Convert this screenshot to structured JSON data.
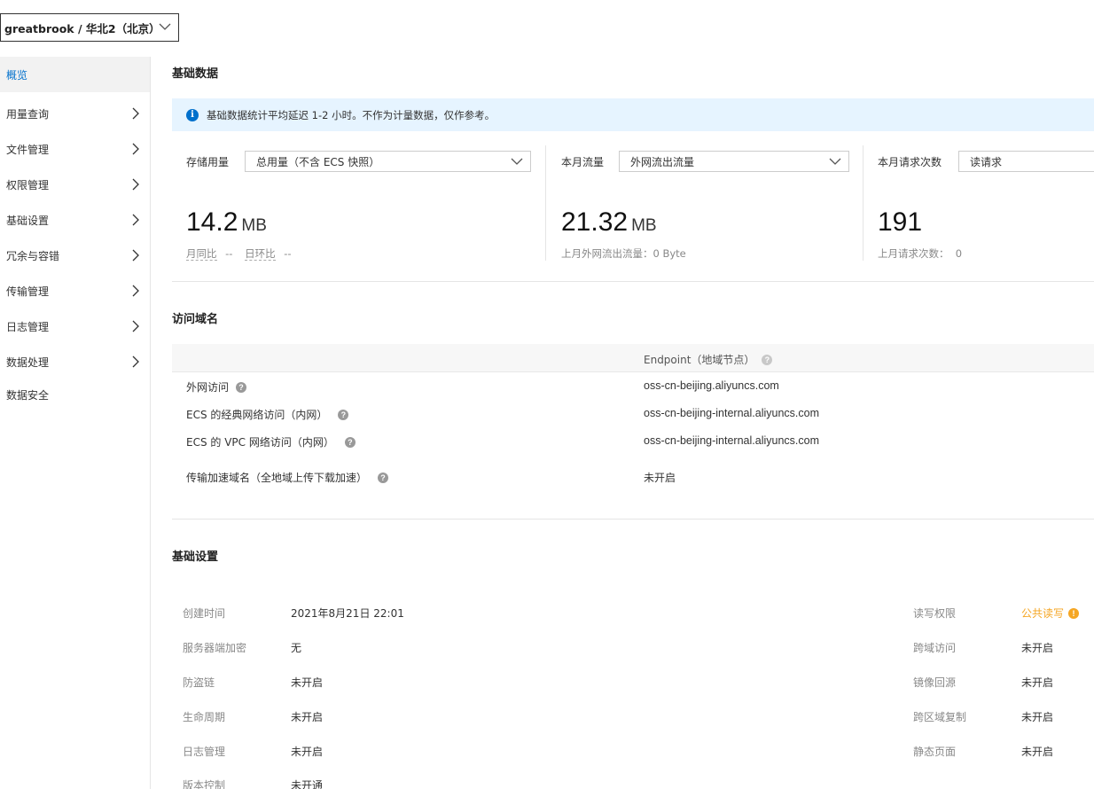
{
  "bucket_selector": {
    "label": "greatbrook / 华北2（北京）"
  },
  "sidebar": {
    "items": [
      {
        "label": "概览",
        "active": true,
        "has_arrow": false
      },
      {
        "label": "用量查询",
        "has_arrow": true
      },
      {
        "label": "文件管理",
        "has_arrow": true
      },
      {
        "label": "权限管理",
        "has_arrow": true
      },
      {
        "label": "基础设置",
        "has_arrow": true
      },
      {
        "label": "冗余与容错",
        "has_arrow": true
      },
      {
        "label": "传输管理",
        "has_arrow": true
      },
      {
        "label": "日志管理",
        "has_arrow": true
      },
      {
        "label": "数据处理",
        "has_arrow": true
      },
      {
        "label": "数据安全",
        "has_arrow": false
      }
    ]
  },
  "basic_data": {
    "title": "基础数据",
    "notice": "基础数据统计平均延迟 1-2 小时。不作为计量数据，仅作参考。",
    "storage": {
      "label": "存储用量",
      "dropdown": "总用量（不含 ECS 快照）",
      "value": "14.2",
      "unit": "MB",
      "mom_label": "月同比",
      "mom_value": "--",
      "dod_label": "日环比",
      "dod_value": "--"
    },
    "traffic": {
      "label": "本月流量",
      "dropdown": "外网流出流量",
      "value": "21.32",
      "unit": "MB",
      "sub": "上月外网流出流量：0 Byte"
    },
    "requests": {
      "label": "本月请求次数",
      "dropdown": "读请求",
      "value": "191",
      "sub": "上月请求次数：  0"
    }
  },
  "domains": {
    "title": "访问域名",
    "column_header": "Endpoint（地域节点）",
    "rows": [
      {
        "name": "外网访问",
        "value": "oss-cn-beijing.aliyuncs.com"
      },
      {
        "name": "ECS 的经典网络访问（内网）",
        "value": "oss-cn-beijing-internal.aliyuncs.com"
      },
      {
        "name": "ECS 的 VPC 网络访问（内网）",
        "value": "oss-cn-beijing-internal.aliyuncs.com"
      },
      {
        "name": "传输加速域名（全地域上传下载加速）",
        "value": "未开启"
      }
    ]
  },
  "settings": {
    "title": "基础设置",
    "left": [
      {
        "key": "创建时间",
        "value": "2021年8月21日 22:01"
      },
      {
        "key": "服务器端加密",
        "value": "无"
      },
      {
        "key": "防盗链",
        "value": "未开启"
      },
      {
        "key": "生命周期",
        "value": "未开启"
      },
      {
        "key": "日志管理",
        "value": "未开启"
      },
      {
        "key": "版本控制",
        "value": "未开通"
      }
    ],
    "right": [
      {
        "key": "读写权限",
        "value": "公共读写"
      },
      {
        "key": "跨域访问",
        "value": "未开启"
      },
      {
        "key": "镜像回源",
        "value": "未开启"
      },
      {
        "key": "跨区域复制",
        "value": "未开启"
      },
      {
        "key": "静态页面",
        "value": "未开启"
      }
    ]
  },
  "colors": {
    "accent": "#0070cc",
    "warning": "#f5a623",
    "notice_bg": "#e6f4ff"
  },
  "icons": [
    "chevron-down-icon",
    "chevron-right-icon",
    "info-icon",
    "question-icon",
    "warning-icon"
  ]
}
